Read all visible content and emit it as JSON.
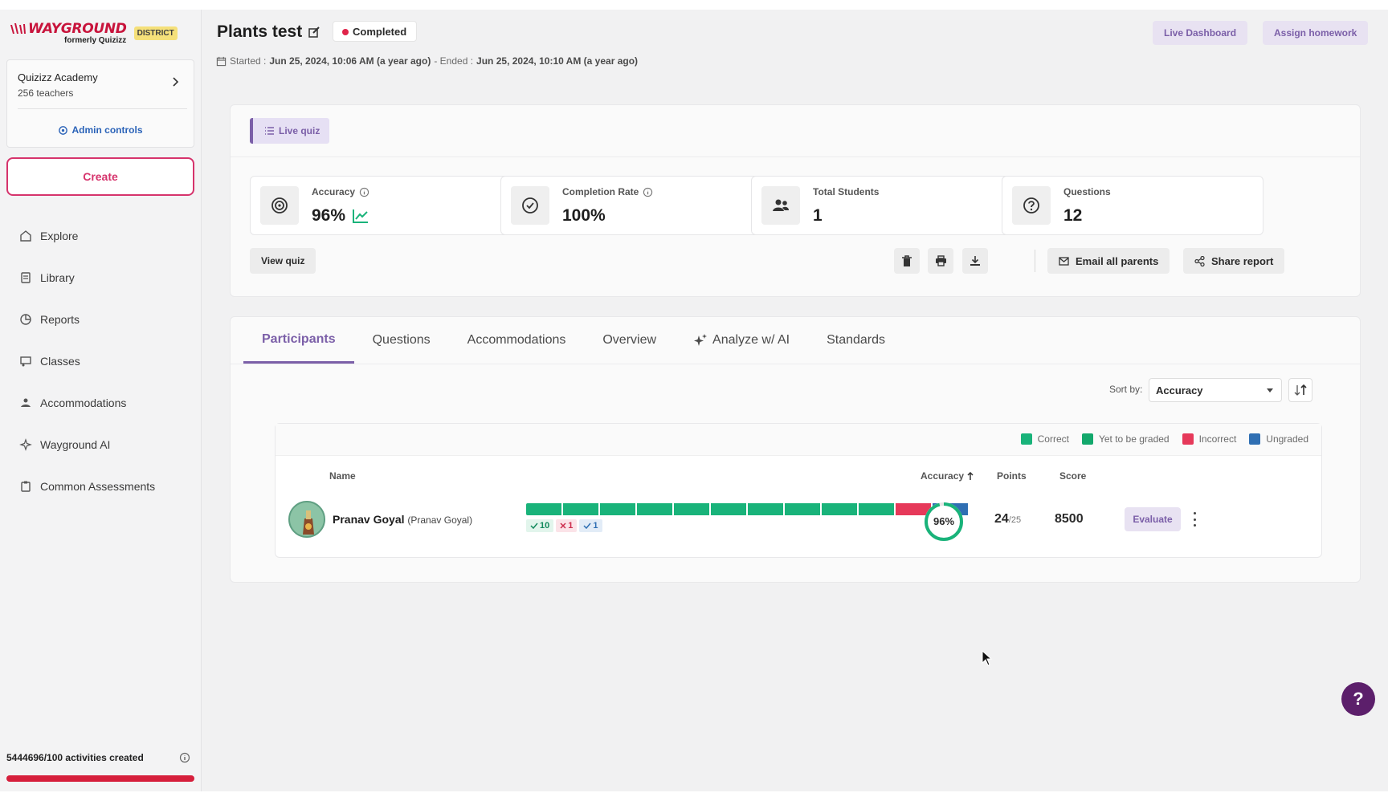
{
  "brand": {
    "logo_text": "WAYGROUND",
    "logo_sub": "formerly Quizizz",
    "badge": "DISTRICT"
  },
  "org": {
    "name": "Quizizz Academy",
    "teachers": "256 teachers",
    "admin_label": "Admin controls"
  },
  "sidebar": {
    "create_label": "Create",
    "items": [
      {
        "label": "Explore",
        "icon": "home-icon"
      },
      {
        "label": "Library",
        "icon": "library-icon"
      },
      {
        "label": "Reports",
        "icon": "reports-icon"
      },
      {
        "label": "Classes",
        "icon": "classes-icon"
      },
      {
        "label": "Accommodations",
        "icon": "accommodations-icon"
      },
      {
        "label": "Wayground AI",
        "icon": "sparkle-icon"
      },
      {
        "label": "Common Assessments",
        "icon": "clipboard-icon"
      }
    ],
    "activities_text": "5444696/100 activities created",
    "activities_progress": 1.0
  },
  "header": {
    "title": "Plants test",
    "status": "Completed",
    "started_label": "Started :",
    "started_value": "Jun 25, 2024, 10:06 AM (a year ago)",
    "ended_label": "- Ended :",
    "ended_value": "Jun 25, 2024, 10:10 AM (a year ago)",
    "live_dashboard": "Live Dashboard",
    "assign_homework": "Assign homework"
  },
  "summary": {
    "mode_tag": "Live quiz",
    "stats": [
      {
        "label": "Accuracy",
        "value": "96%"
      },
      {
        "label": "Completion Rate",
        "value": "100%"
      },
      {
        "label": "Total Students",
        "value": "1"
      },
      {
        "label": "Questions",
        "value": "12"
      }
    ],
    "view_quiz": "View quiz",
    "email_parents": "Email all parents",
    "share_report": "Share report"
  },
  "tabs": [
    "Participants",
    "Questions",
    "Accommodations",
    "Overview",
    "Analyze w/ AI",
    "Standards"
  ],
  "active_tab": "Participants",
  "sort": {
    "label": "Sort by:",
    "value": "Accuracy"
  },
  "legend": [
    {
      "label": "Correct",
      "color": "#19b37a"
    },
    {
      "label": "Yet to be graded",
      "color": "#13a86c"
    },
    {
      "label": "Incorrect",
      "color": "#e6395a"
    },
    {
      "label": "Ungraded",
      "color": "#2f6fb3"
    }
  ],
  "table": {
    "headers": {
      "name": "Name",
      "accuracy": "Accuracy",
      "points": "Points",
      "score": "Score"
    },
    "rows": [
      {
        "name": "Pranav Goyal",
        "alias": "(Pranav Goyal)",
        "questions": [
          "correct",
          "correct",
          "correct",
          "correct",
          "correct",
          "correct",
          "correct",
          "correct",
          "correct",
          "correct",
          "incorrect",
          "ungraded"
        ],
        "correct_count": "10",
        "incorrect_count": "1",
        "graded_count": "1",
        "accuracy": "96%",
        "accuracy_value": 0.96,
        "points": "24",
        "points_total": "/25",
        "score": "8500",
        "action": "Evaluate"
      }
    ]
  },
  "help_label": "?"
}
